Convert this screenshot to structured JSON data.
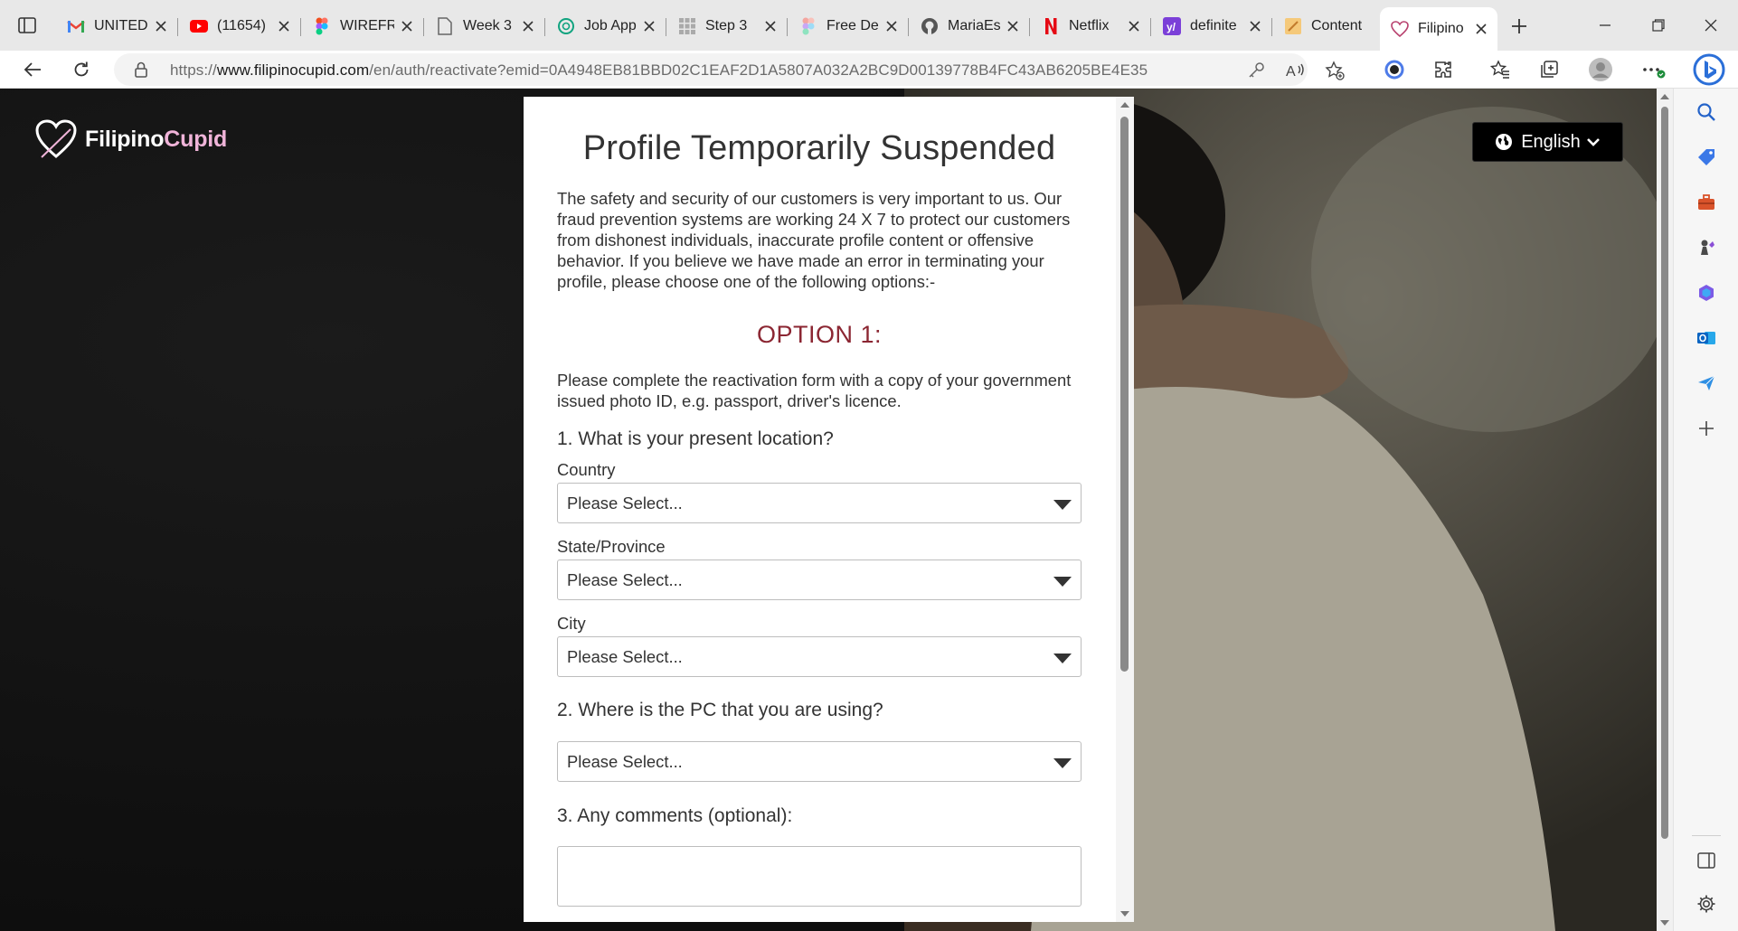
{
  "browser": {
    "tabs": [
      {
        "title": "UNITED",
        "icon": "gmail-icon"
      },
      {
        "title": "(11654)",
        "icon": "youtube-icon"
      },
      {
        "title": "WIREFR",
        "icon": "figma-icon"
      },
      {
        "title": "Week 3",
        "icon": "document-icon"
      },
      {
        "title": "Job App",
        "icon": "chatgpt-icon"
      },
      {
        "title": "Step 3",
        "icon": "grid-icon"
      },
      {
        "title": "Free De",
        "icon": "figma-icon"
      },
      {
        "title": "MariaEs",
        "icon": "github-icon"
      },
      {
        "title": "Netflix",
        "icon": "netflix-icon"
      },
      {
        "title": "definite",
        "icon": "yahoo-icon"
      },
      {
        "title": "Content",
        "icon": "notes-icon"
      },
      {
        "title": "Filipino",
        "icon": "heart-icon",
        "active": true
      }
    ],
    "url": {
      "scheme": "https://",
      "host": "www.filipinocupid.com",
      "path": "/en/auth/reactivate?emid=0A4948EB81BBD02C1EAF2D1A5807A032A2BC9D00139778B4FC43AB6205BE4E35"
    }
  },
  "page": {
    "logo": {
      "part1": "Filipino",
      "part2": "Cupid"
    },
    "language": "English",
    "modal": {
      "title": "Profile Temporarily Suspended",
      "intro": "The safety and security of our customers is very important to us. Our fraud prevention systems are working 24 X 7 to protect our customers from dishonest individuals, inaccurate profile content or offensive behavior. If you believe we have made an error in terminating your profile, please choose one of the following options:-",
      "option_heading": "OPTION 1:",
      "option_text": "Please complete the reactivation form with a copy of your government issued photo ID, e.g. passport, driver's licence.",
      "q1": "1. What is your present location?",
      "country_label": "Country",
      "country_value": "Please Select...",
      "state_label": "State/Province",
      "state_value": "Please Select...",
      "city_label": "City",
      "city_value": "Please Select...",
      "q2": "2. Where is the PC that you are using?",
      "pc_value": "Please Select...",
      "q3": "3. Any comments (optional):",
      "comments_value": ""
    }
  },
  "colors": {
    "option_heading": "#8b2632",
    "logo_accent": "#f0b4d9",
    "language_bg": "#000000"
  }
}
